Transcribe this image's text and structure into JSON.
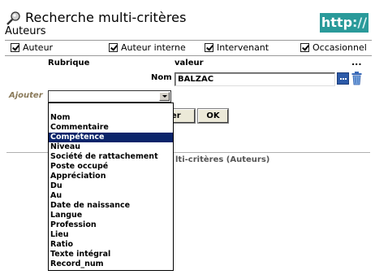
{
  "header": {
    "title": "Recherche multi-critères",
    "subtitle": "Auteurs",
    "logo_text": "http",
    "logo_slashes": "://"
  },
  "filters": [
    {
      "label": "Auteur",
      "checked": true
    },
    {
      "label": "Auteur interne",
      "checked": true
    },
    {
      "label": "Intervenant",
      "checked": true
    },
    {
      "label": "Occasionnel",
      "checked": true
    }
  ],
  "table": {
    "col_rubrique": "Rubrique",
    "col_valeur": "valeur",
    "more": "...",
    "row_label": "Nom",
    "row_value": "BALZAC"
  },
  "ajouter": {
    "label": "Ajouter",
    "selected": ""
  },
  "buttons": {
    "lancer_partial": "cer",
    "ok": "OK"
  },
  "result_title_partial": "lti-critères (Auteurs)",
  "dropdown": {
    "selected_index": 2,
    "options": [
      "Nom",
      "Commentaire",
      "Compétence",
      "Niveau",
      "Société de rattachement",
      "Poste occupé",
      "Appréciation",
      "Du",
      "Au",
      "Date de naissance",
      "Langue",
      "Profession",
      "Lieu",
      "Ratio",
      "Texte intégral",
      "Record_num"
    ]
  },
  "colors": {
    "logo_bg": "#2a9a9a",
    "selection_bg": "#0a246a",
    "ajouter_label": "#8a7a5a"
  }
}
